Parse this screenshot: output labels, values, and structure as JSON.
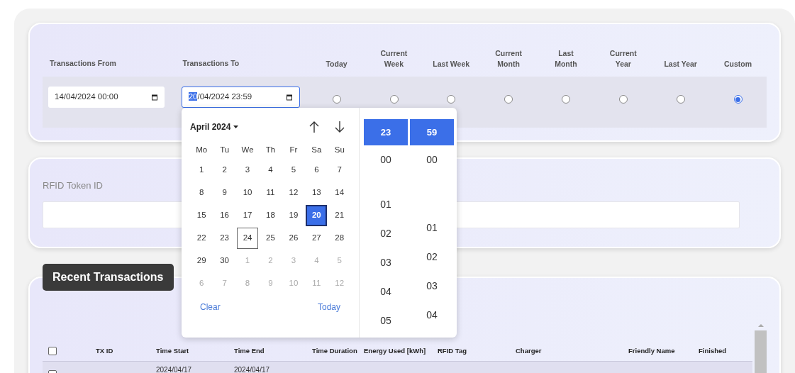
{
  "filters": {
    "from": {
      "label": "Transactions From",
      "segments": [
        {
          "text": "14/04/2024 00:00",
          "selected": false
        }
      ]
    },
    "to": {
      "label": "Transactions To",
      "segments": [
        {
          "text": "20",
          "selected": true
        },
        {
          "text": "/04/2024 23:59",
          "selected": false
        }
      ]
    },
    "presets": [
      {
        "label": "Today",
        "selected": false
      },
      {
        "label": "Current Week",
        "selected": false
      },
      {
        "label": "Last Week",
        "selected": false
      },
      {
        "label": "Current Month",
        "selected": false
      },
      {
        "label": "Last Month",
        "selected": false
      },
      {
        "label": "Current Year",
        "selected": false
      },
      {
        "label": "Last Year",
        "selected": false
      },
      {
        "label": "Custom",
        "selected": true
      }
    ]
  },
  "rfid": {
    "label": "RFID Token ID"
  },
  "transactions": {
    "title": "Recent Transactions",
    "header_checkbox": {
      "checked": false
    },
    "columns": [
      "TX ID",
      "Time Start",
      "Time End",
      "Time Duration",
      "Energy Used [kWh]",
      "RFID Tag",
      "Charger",
      "Friendly Name",
      "Finished"
    ],
    "rows": [
      {
        "checked": false,
        "time_start": "2024/04/17",
        "time_end": "2024/04/17"
      }
    ]
  },
  "picker": {
    "month": "April 2024",
    "weekdays": [
      "Mo",
      "Tu",
      "We",
      "Th",
      "Fr",
      "Sa",
      "Su"
    ],
    "weeks": [
      [
        {
          "label": "1",
          "outside": false,
          "selected": false,
          "today": false
        },
        {
          "label": "2",
          "outside": false,
          "selected": false,
          "today": false
        },
        {
          "label": "3",
          "outside": false,
          "selected": false,
          "today": false
        },
        {
          "label": "4",
          "outside": false,
          "selected": false,
          "today": false
        },
        {
          "label": "5",
          "outside": false,
          "selected": false,
          "today": false
        },
        {
          "label": "6",
          "outside": false,
          "selected": false,
          "today": false
        },
        {
          "label": "7",
          "outside": false,
          "selected": false,
          "today": false
        }
      ],
      [
        {
          "label": "8",
          "outside": false,
          "selected": false,
          "today": false
        },
        {
          "label": "9",
          "outside": false,
          "selected": false,
          "today": false
        },
        {
          "label": "10",
          "outside": false,
          "selected": false,
          "today": false
        },
        {
          "label": "11",
          "outside": false,
          "selected": false,
          "today": false
        },
        {
          "label": "12",
          "outside": false,
          "selected": false,
          "today": false
        },
        {
          "label": "13",
          "outside": false,
          "selected": false,
          "today": false
        },
        {
          "label": "14",
          "outside": false,
          "selected": false,
          "today": false
        }
      ],
      [
        {
          "label": "15",
          "outside": false,
          "selected": false,
          "today": false
        },
        {
          "label": "16",
          "outside": false,
          "selected": false,
          "today": false
        },
        {
          "label": "17",
          "outside": false,
          "selected": false,
          "today": false
        },
        {
          "label": "18",
          "outside": false,
          "selected": false,
          "today": false
        },
        {
          "label": "19",
          "outside": false,
          "selected": false,
          "today": false
        },
        {
          "label": "20",
          "outside": false,
          "selected": true,
          "today": false
        },
        {
          "label": "21",
          "outside": false,
          "selected": false,
          "today": false
        }
      ],
      [
        {
          "label": "22",
          "outside": false,
          "selected": false,
          "today": false
        },
        {
          "label": "23",
          "outside": false,
          "selected": false,
          "today": false
        },
        {
          "label": "24",
          "outside": false,
          "selected": false,
          "today": true
        },
        {
          "label": "25",
          "outside": false,
          "selected": false,
          "today": false
        },
        {
          "label": "26",
          "outside": false,
          "selected": false,
          "today": false
        },
        {
          "label": "27",
          "outside": false,
          "selected": false,
          "today": false
        },
        {
          "label": "28",
          "outside": false,
          "selected": false,
          "today": false
        }
      ],
      [
        {
          "label": "29",
          "outside": false,
          "selected": false,
          "today": false
        },
        {
          "label": "30",
          "outside": false,
          "selected": false,
          "today": false
        },
        {
          "label": "1",
          "outside": true,
          "selected": false,
          "today": false
        },
        {
          "label": "2",
          "outside": true,
          "selected": false,
          "today": false
        },
        {
          "label": "3",
          "outside": true,
          "selected": false,
          "today": false
        },
        {
          "label": "4",
          "outside": true,
          "selected": false,
          "today": false
        },
        {
          "label": "5",
          "outside": true,
          "selected": false,
          "today": false
        }
      ],
      [
        {
          "label": "6",
          "outside": true,
          "selected": false,
          "today": false
        },
        {
          "label": "7",
          "outside": true,
          "selected": false,
          "today": false
        },
        {
          "label": "8",
          "outside": true,
          "selected": false,
          "today": false
        },
        {
          "label": "9",
          "outside": true,
          "selected": false,
          "today": false
        },
        {
          "label": "10",
          "outside": true,
          "selected": false,
          "today": false
        },
        {
          "label": "11",
          "outside": true,
          "selected": false,
          "today": false
        },
        {
          "label": "12",
          "outside": true,
          "selected": false,
          "today": false
        }
      ]
    ],
    "clear": "Clear",
    "today": "Today",
    "hours": [
      {
        "label": "23",
        "selected": true
      },
      {
        "label": "00",
        "selected": false
      },
      {
        "label": "01",
        "selected": false
      },
      {
        "label": "02",
        "selected": false
      },
      {
        "label": "03",
        "selected": false
      },
      {
        "label": "04",
        "selected": false
      },
      {
        "label": "05",
        "selected": false
      }
    ],
    "minutes": [
      {
        "label": "59",
        "selected": true
      },
      {
        "label": "00",
        "selected": false
      },
      {
        "label": "01",
        "selected": false
      },
      {
        "label": "02",
        "selected": false
      },
      {
        "label": "03",
        "selected": false
      },
      {
        "label": "04",
        "selected": false
      }
    ]
  }
}
